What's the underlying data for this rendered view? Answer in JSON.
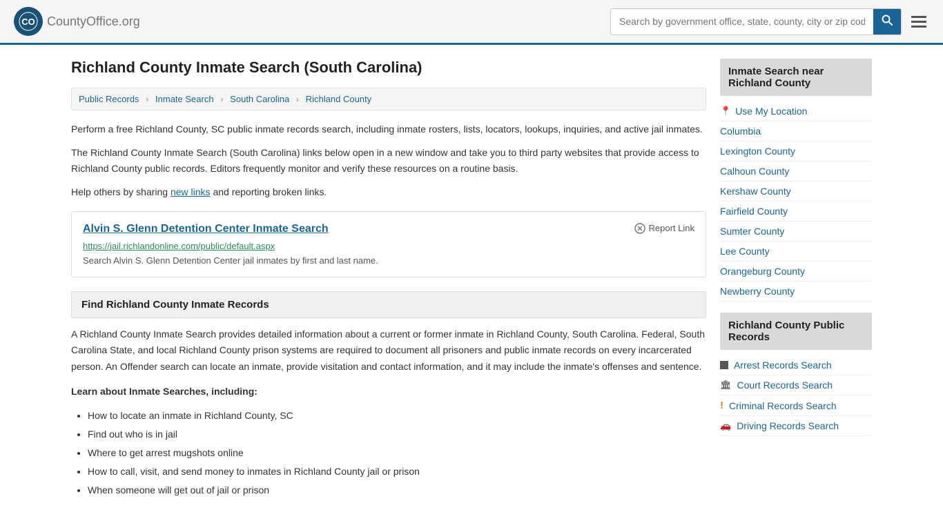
{
  "header": {
    "logo_text": "CountyOffice",
    "logo_suffix": ".org",
    "search_placeholder": "Search by government office, state, county, city or zip code",
    "search_value": ""
  },
  "page": {
    "title": "Richland County Inmate Search (South Carolina)"
  },
  "breadcrumb": {
    "items": [
      {
        "label": "Public Records",
        "href": "#"
      },
      {
        "label": "Inmate Search",
        "href": "#"
      },
      {
        "label": "South Carolina",
        "href": "#"
      },
      {
        "label": "Richland County",
        "href": "#"
      }
    ]
  },
  "description": {
    "para1": "Perform a free Richland County, SC public inmate records search, including inmate rosters, lists, locators, lookups, inquiries, and active jail inmates.",
    "para2": "The Richland County Inmate Search (South Carolina) links below open in a new window and take you to third party websites that provide access to Richland County public records. Editors frequently monitor and verify these resources on a routine basis.",
    "para3_before": "Help others by sharing ",
    "para3_link": "new links",
    "para3_after": " and reporting broken links."
  },
  "link_card": {
    "title": "Alvin S. Glenn Detention Center Inmate Search",
    "url": "https://jail.richlandonline.com/public/default.aspx",
    "description": "Search Alvin S. Glenn Detention Center jail inmates by first and last name.",
    "report_label": "Report Link"
  },
  "section_box": {
    "title": "Find Richland County Inmate Records"
  },
  "inmate_records": {
    "intro": "A Richland County Inmate Search provides detailed information about a current or former inmate in Richland County, South Carolina. Federal, South Carolina State, and local Richland County prison systems are required to document all prisoners and public inmate records on every incarcerated person. An Offender search can locate an inmate, provide visitation and contact information, and it may include the inmate's offenses and sentence.",
    "learn_label": "Learn about Inmate Searches, including:",
    "bullets": [
      "How to locate an inmate in Richland County, SC",
      "Find out who is in jail",
      "Where to get arrest mugshots online",
      "How to call, visit, and send money to inmates in Richland County jail or prison",
      "When someone will get out of jail or prison"
    ]
  },
  "sidebar": {
    "nearby_title": "Inmate Search near Richland County",
    "use_location_label": "Use My Location",
    "nearby_links": [
      {
        "label": "Columbia"
      },
      {
        "label": "Lexington County"
      },
      {
        "label": "Calhoun County"
      },
      {
        "label": "Kershaw County"
      },
      {
        "label": "Fairfield County"
      },
      {
        "label": "Sumter County"
      },
      {
        "label": "Lee County"
      },
      {
        "label": "Orangeburg County"
      },
      {
        "label": "Newberry County"
      }
    ],
    "public_records_title": "Richland County Public Records",
    "public_records_links": [
      {
        "label": "Arrest Records Search",
        "icon": "square"
      },
      {
        "label": "Court Records Search",
        "icon": "court"
      },
      {
        "label": "Criminal Records Search",
        "icon": "exclaim"
      },
      {
        "label": "Driving Records Search",
        "icon": "drive"
      }
    ]
  }
}
